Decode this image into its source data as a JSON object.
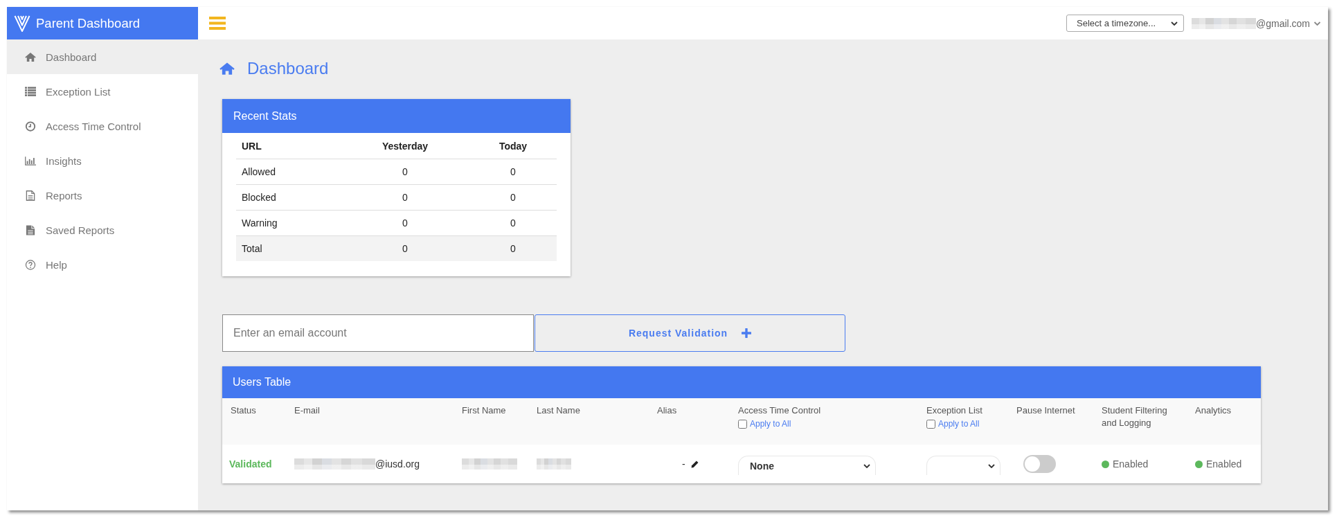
{
  "sidebar": {
    "brand": "Parent Dashboard",
    "items": [
      {
        "label": "Dashboard",
        "selected": true
      },
      {
        "label": "Exception List",
        "selected": false
      },
      {
        "label": "Access Time Control",
        "selected": false
      },
      {
        "label": "Insights",
        "selected": false
      },
      {
        "label": "Reports",
        "selected": false
      },
      {
        "label": "Saved Reports",
        "selected": false
      },
      {
        "label": "Help",
        "selected": false
      }
    ]
  },
  "top_bar": {
    "timezone_select": {
      "value": "Select a timezone..."
    },
    "user_email": {
      "redacted": true,
      "text": "@gmail.com"
    }
  },
  "page_title": "Dashboard",
  "recent_stats": {
    "title": "Recent Stats",
    "columns": [
      "URL",
      "Yesterday",
      "Today"
    ],
    "rows": [
      {
        "kind": "data",
        "cells": [
          "Allowed",
          "0",
          "0"
        ]
      },
      {
        "kind": "data",
        "cells": [
          "Blocked",
          "0",
          "0"
        ]
      },
      {
        "kind": "data",
        "cells": [
          "Warning",
          "0",
          "0"
        ]
      },
      {
        "kind": "total",
        "cells": [
          "Total",
          "0",
          "0"
        ]
      }
    ]
  },
  "validation_form": {
    "email_field": {
      "placeholder": "Enter an email account"
    },
    "button": "Request Validation"
  },
  "users_table": {
    "title": "Users Table",
    "columns": [
      {
        "label": "Status"
      },
      {
        "label": "E-mail"
      },
      {
        "label": "First Name"
      },
      {
        "label": "Last Name"
      },
      {
        "label": "Alias"
      },
      {
        "label": "Access Time Control",
        "apply_all": {
          "label": "Apply to All",
          "checked": false
        }
      },
      {
        "label": "Exception List",
        "apply_all": {
          "label": "Apply to All",
          "checked": false
        }
      },
      {
        "label": "Pause Internet"
      },
      {
        "label": "Student Filtering and Logging"
      },
      {
        "label": "Analytics"
      }
    ],
    "rows": [
      {
        "cells": [
          {
            "kind": "status",
            "text": "Validated",
            "color": "#5cb85c"
          },
          {
            "kind": "email",
            "redacted": true,
            "text": "@iusd.org"
          },
          {
            "kind": "redacted"
          },
          {
            "kind": "redacted"
          },
          {
            "kind": "alias",
            "text": "-"
          },
          {
            "kind": "select",
            "value": "None"
          },
          {
            "kind": "select"
          },
          {
            "kind": "toggle",
            "on": false
          },
          {
            "kind": "dot",
            "text": "Enabled",
            "color": "#5cb85c"
          },
          {
            "kind": "dot",
            "text": "Enabled",
            "color": "#5cb85c"
          }
        ]
      }
    ]
  }
}
